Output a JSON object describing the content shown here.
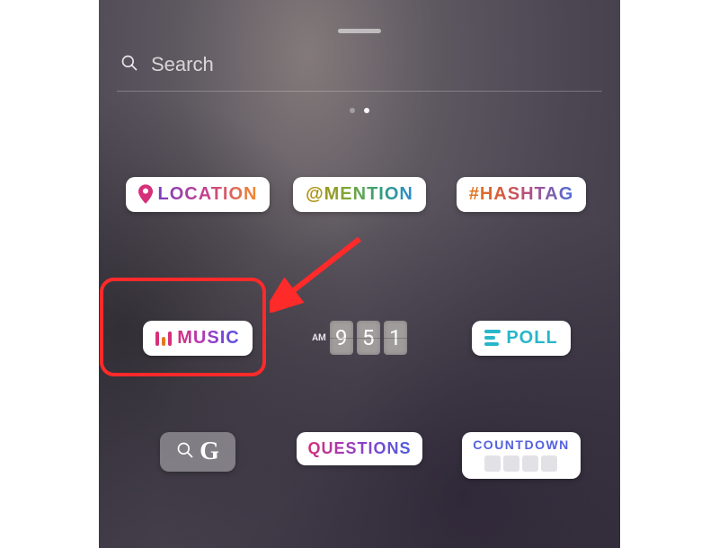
{
  "search": {
    "placeholder": "Search"
  },
  "pager": {
    "count": 2,
    "activeIndex": 1
  },
  "stickers": {
    "location": {
      "label": "LOCATION"
    },
    "mention": {
      "label": "@MENTION"
    },
    "hashtag": {
      "label": "#HASHTAG"
    },
    "music": {
      "label": "MUSIC"
    },
    "time": {
      "ampm": "AM",
      "d1": "9",
      "d2": "5",
      "d3": "1"
    },
    "poll": {
      "label": "POLL"
    },
    "gif": {
      "letter": "G"
    },
    "questions": {
      "label": "QUESTIONS"
    },
    "countdown": {
      "label": "COUNTDOWN"
    }
  },
  "annotation": {
    "highlight_target": "music-sticker",
    "arrow_points_to": "music-sticker"
  }
}
